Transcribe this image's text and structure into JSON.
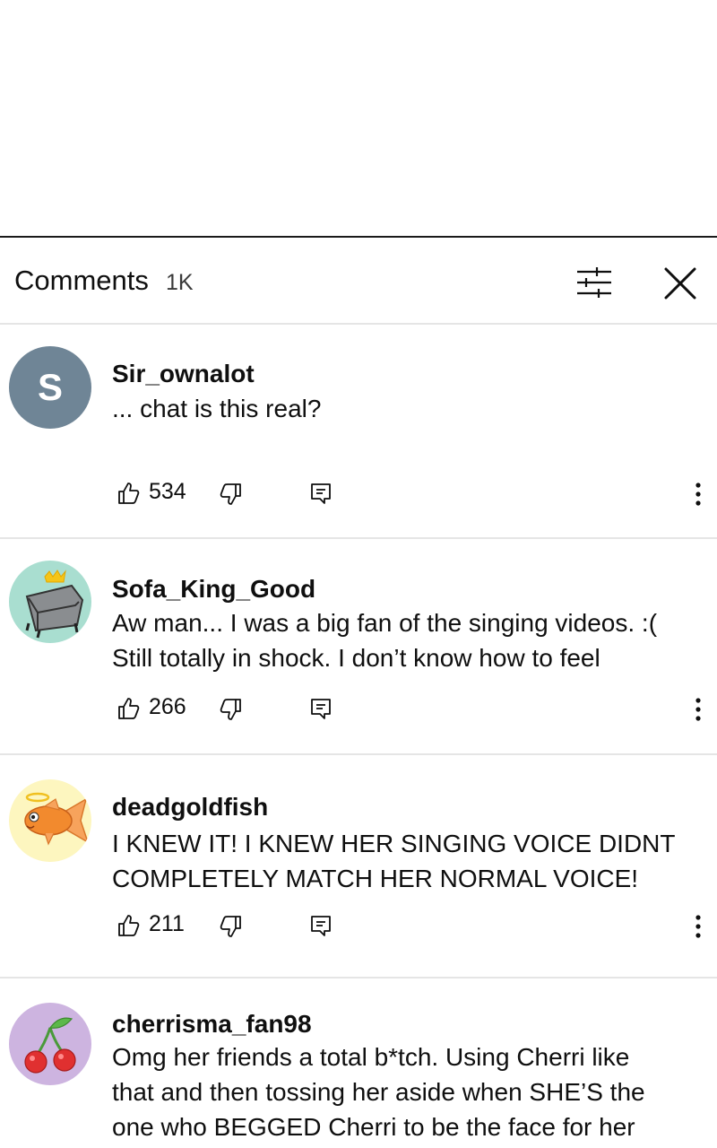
{
  "panel": {
    "title": "Comments",
    "count": "1K"
  },
  "comments": [
    {
      "username": "Sir_ownalot",
      "avatar_letter": "S",
      "avatar_color": "#6f8596",
      "text": "... chat is this real?",
      "likes": "534"
    },
    {
      "username": "Sofa_King_Good",
      "avatar_icon": "armchair-with-crown-icon",
      "avatar_color": "#a9ded0",
      "text_lines": [
        "Aw man... I was a big fan of the singing videos. :(",
        "Still totally in shock. I don’t know how to feel"
      ],
      "likes": "266"
    },
    {
      "username": "deadgoldfish",
      "avatar_icon": "goldfish-with-halo-icon",
      "avatar_color": "#fdf6bf",
      "text_lines": [
        "I KNEW IT! I KNEW HER SINGING VOICE DIDNT",
        "COMPLETELY MATCH HER NORMAL VOICE!"
      ],
      "likes": "211"
    },
    {
      "username": "cherrisma_fan98",
      "avatar_icon": "cherries-icon",
      "avatar_color": "#cdb4e0",
      "text_lines": [
        "Omg her friends a total b*tch. Using Cherri like",
        "that and then tossing her aside when SHE’S the",
        "one who BEGGED Cherri to be the face for her"
      ]
    }
  ]
}
